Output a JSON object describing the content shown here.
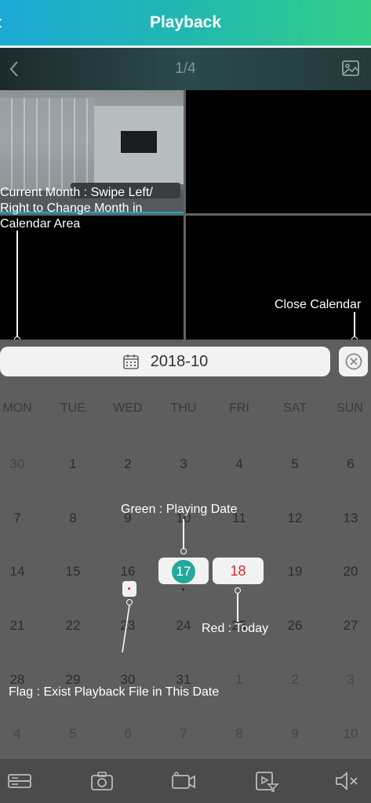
{
  "header": {
    "title": "Playback",
    "back_icon": "chevron-left-icon"
  },
  "pagebar": {
    "counter": "1/4",
    "prev_icon": "chevron-left-icon",
    "gallery_icon": "image-icon"
  },
  "annotations": {
    "current_month": "Current Month : Swipe Left/\nRight to Change Month in\nCalendar Area",
    "close_calendar": "Close Calendar",
    "green": "Green : Playing Date",
    "red": "Red : Today",
    "flag": "Flag : Exist Playback File in This Date"
  },
  "calendar": {
    "month": "2018-10",
    "weekdays": [
      "MON",
      "TUE",
      "WED",
      "THU",
      "FRI",
      "SAT",
      "SUN"
    ],
    "weeks": [
      [
        "30",
        "1",
        "2",
        "3",
        "4",
        "5",
        "6"
      ],
      [
        "7",
        "8",
        "9",
        "10",
        "11",
        "12",
        "13"
      ],
      [
        "14",
        "15",
        "16",
        "17",
        "18",
        "19",
        "20"
      ],
      [
        "21",
        "22",
        "23",
        "24",
        "25",
        "26",
        "27"
      ],
      [
        "28",
        "29",
        "30",
        "31",
        "1",
        "2",
        "3"
      ],
      [
        "4",
        "5",
        "6",
        "7",
        "8",
        "9",
        "10"
      ]
    ],
    "playing_date": "17",
    "today": "18",
    "colors": {
      "playing": "#23a99c",
      "today": "#e0262c"
    }
  },
  "toolbar": {
    "icons": [
      "storage-device-icon",
      "camera-snapshot-icon",
      "video-record-icon",
      "playback-filter-icon",
      "mute-icon"
    ]
  }
}
